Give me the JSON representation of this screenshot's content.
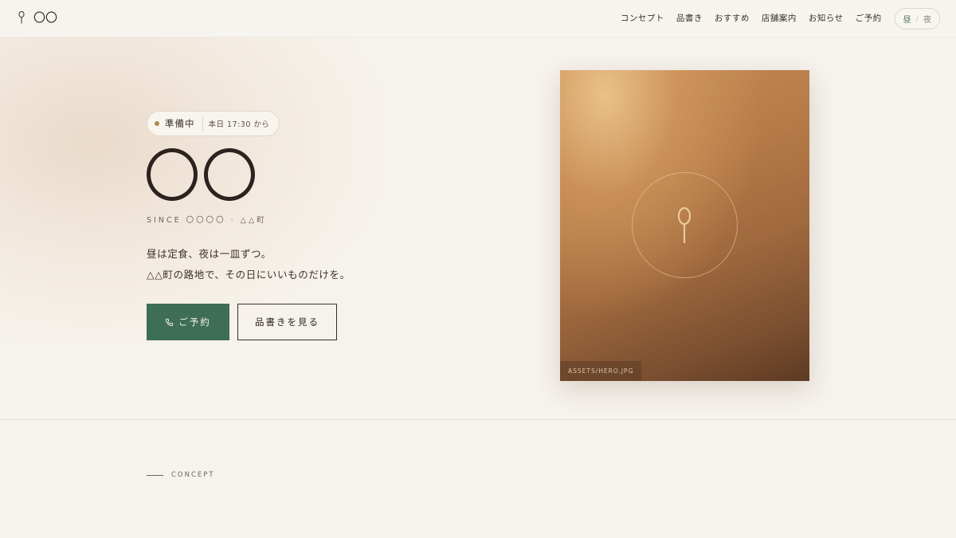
{
  "header": {
    "logo_text": "〇〇",
    "nav": [
      "コンセプト",
      "品書き",
      "おすすめ",
      "店舗案内",
      "お知らせ",
      "ご予約"
    ],
    "toggle": {
      "day": "昼",
      "separator": "/",
      "night": "夜"
    }
  },
  "hero": {
    "status_label": "準備中",
    "status_time": "本日 17:30 から",
    "title": "〇〇",
    "since": "SINCE 〇〇〇〇 · △△町",
    "tagline_line1": "昼は定食、夜は一皿ずつ。",
    "tagline_line2": "△△町の路地で、その日にいいものだけを。",
    "reserve_button": "ご予約",
    "menu_button": "品書きを見る",
    "image_caption": "ASSETS/HERO.JPG"
  },
  "concept": {
    "label": "CONCEPT"
  },
  "colors": {
    "accent_green": "#3f6e57",
    "status_dot": "#b08a4c",
    "background": "#f6f2ec"
  },
  "icons": [
    "spoon-icon",
    "phone-icon"
  ]
}
